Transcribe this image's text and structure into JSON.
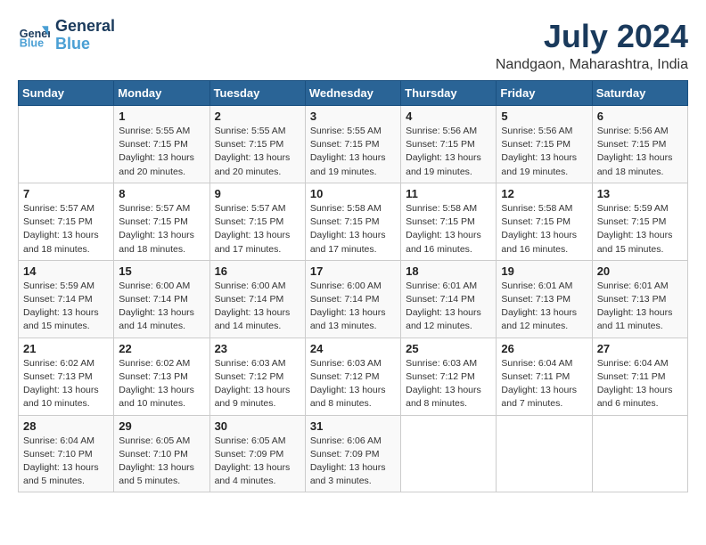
{
  "logo": {
    "line1": "General",
    "line2": "Blue"
  },
  "title": "July 2024",
  "subtitle": "Nandgaon, Maharashtra, India",
  "days_of_week": [
    "Sunday",
    "Monday",
    "Tuesday",
    "Wednesday",
    "Thursday",
    "Friday",
    "Saturday"
  ],
  "weeks": [
    [
      {
        "day": "",
        "info": ""
      },
      {
        "day": "1",
        "info": "Sunrise: 5:55 AM\nSunset: 7:15 PM\nDaylight: 13 hours\nand 20 minutes."
      },
      {
        "day": "2",
        "info": "Sunrise: 5:55 AM\nSunset: 7:15 PM\nDaylight: 13 hours\nand 20 minutes."
      },
      {
        "day": "3",
        "info": "Sunrise: 5:55 AM\nSunset: 7:15 PM\nDaylight: 13 hours\nand 19 minutes."
      },
      {
        "day": "4",
        "info": "Sunrise: 5:56 AM\nSunset: 7:15 PM\nDaylight: 13 hours\nand 19 minutes."
      },
      {
        "day": "5",
        "info": "Sunrise: 5:56 AM\nSunset: 7:15 PM\nDaylight: 13 hours\nand 19 minutes."
      },
      {
        "day": "6",
        "info": "Sunrise: 5:56 AM\nSunset: 7:15 PM\nDaylight: 13 hours\nand 18 minutes."
      }
    ],
    [
      {
        "day": "7",
        "info": "Sunrise: 5:57 AM\nSunset: 7:15 PM\nDaylight: 13 hours\nand 18 minutes."
      },
      {
        "day": "8",
        "info": "Sunrise: 5:57 AM\nSunset: 7:15 PM\nDaylight: 13 hours\nand 18 minutes."
      },
      {
        "day": "9",
        "info": "Sunrise: 5:57 AM\nSunset: 7:15 PM\nDaylight: 13 hours\nand 17 minutes."
      },
      {
        "day": "10",
        "info": "Sunrise: 5:58 AM\nSunset: 7:15 PM\nDaylight: 13 hours\nand 17 minutes."
      },
      {
        "day": "11",
        "info": "Sunrise: 5:58 AM\nSunset: 7:15 PM\nDaylight: 13 hours\nand 16 minutes."
      },
      {
        "day": "12",
        "info": "Sunrise: 5:58 AM\nSunset: 7:15 PM\nDaylight: 13 hours\nand 16 minutes."
      },
      {
        "day": "13",
        "info": "Sunrise: 5:59 AM\nSunset: 7:15 PM\nDaylight: 13 hours\nand 15 minutes."
      }
    ],
    [
      {
        "day": "14",
        "info": "Sunrise: 5:59 AM\nSunset: 7:14 PM\nDaylight: 13 hours\nand 15 minutes."
      },
      {
        "day": "15",
        "info": "Sunrise: 6:00 AM\nSunset: 7:14 PM\nDaylight: 13 hours\nand 14 minutes."
      },
      {
        "day": "16",
        "info": "Sunrise: 6:00 AM\nSunset: 7:14 PM\nDaylight: 13 hours\nand 14 minutes."
      },
      {
        "day": "17",
        "info": "Sunrise: 6:00 AM\nSunset: 7:14 PM\nDaylight: 13 hours\nand 13 minutes."
      },
      {
        "day": "18",
        "info": "Sunrise: 6:01 AM\nSunset: 7:14 PM\nDaylight: 13 hours\nand 12 minutes."
      },
      {
        "day": "19",
        "info": "Sunrise: 6:01 AM\nSunset: 7:13 PM\nDaylight: 13 hours\nand 12 minutes."
      },
      {
        "day": "20",
        "info": "Sunrise: 6:01 AM\nSunset: 7:13 PM\nDaylight: 13 hours\nand 11 minutes."
      }
    ],
    [
      {
        "day": "21",
        "info": "Sunrise: 6:02 AM\nSunset: 7:13 PM\nDaylight: 13 hours\nand 10 minutes."
      },
      {
        "day": "22",
        "info": "Sunrise: 6:02 AM\nSunset: 7:13 PM\nDaylight: 13 hours\nand 10 minutes."
      },
      {
        "day": "23",
        "info": "Sunrise: 6:03 AM\nSunset: 7:12 PM\nDaylight: 13 hours\nand 9 minutes."
      },
      {
        "day": "24",
        "info": "Sunrise: 6:03 AM\nSunset: 7:12 PM\nDaylight: 13 hours\nand 8 minutes."
      },
      {
        "day": "25",
        "info": "Sunrise: 6:03 AM\nSunset: 7:12 PM\nDaylight: 13 hours\nand 8 minutes."
      },
      {
        "day": "26",
        "info": "Sunrise: 6:04 AM\nSunset: 7:11 PM\nDaylight: 13 hours\nand 7 minutes."
      },
      {
        "day": "27",
        "info": "Sunrise: 6:04 AM\nSunset: 7:11 PM\nDaylight: 13 hours\nand 6 minutes."
      }
    ],
    [
      {
        "day": "28",
        "info": "Sunrise: 6:04 AM\nSunset: 7:10 PM\nDaylight: 13 hours\nand 5 minutes."
      },
      {
        "day": "29",
        "info": "Sunrise: 6:05 AM\nSunset: 7:10 PM\nDaylight: 13 hours\nand 5 minutes."
      },
      {
        "day": "30",
        "info": "Sunrise: 6:05 AM\nSunset: 7:09 PM\nDaylight: 13 hours\nand 4 minutes."
      },
      {
        "day": "31",
        "info": "Sunrise: 6:06 AM\nSunset: 7:09 PM\nDaylight: 13 hours\nand 3 minutes."
      },
      {
        "day": "",
        "info": ""
      },
      {
        "day": "",
        "info": ""
      },
      {
        "day": "",
        "info": ""
      }
    ]
  ]
}
